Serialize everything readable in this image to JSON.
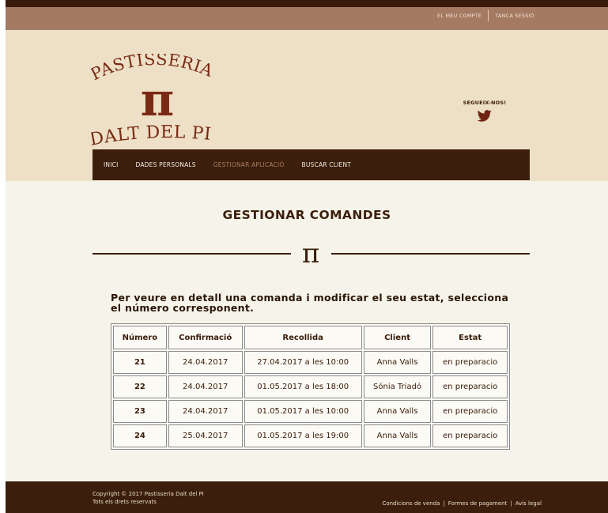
{
  "topbar": {
    "account_label": "EL MEU COMPTE",
    "logout_label": "TANCA SESSIÓ"
  },
  "logo": {
    "line1": "PASTISSERIA",
    "symbol": "π",
    "line2": "DALT DEL PI"
  },
  "social": {
    "label": "SEGUEIX-NOS!",
    "icon": "twitter-icon"
  },
  "nav": {
    "items": [
      {
        "label": "INICI",
        "active": false
      },
      {
        "label": "DADES PERSONALS",
        "active": false
      },
      {
        "label": "GESTIONAR APLICACIÓ",
        "active": true
      },
      {
        "label": "BUSCAR CLIENT",
        "active": false
      }
    ]
  },
  "main": {
    "title": "GESTIONAR COMANDES",
    "divider_symbol": "π",
    "intro": "Per veure en detall una comanda i modificar el seu estat, selecciona el número corresponent."
  },
  "table": {
    "headers": [
      "Número",
      "Confirmació",
      "Recollida",
      "Client",
      "Estat"
    ],
    "rows": [
      [
        "21",
        "24.04.2017",
        "27.04.2017 a les 10:00",
        "Anna Valls",
        "en preparacio"
      ],
      [
        "22",
        "24.04.2017",
        "01.05.2017 a les 18:00",
        "Sónia Triadó",
        "en preparacio"
      ],
      [
        "23",
        "24.04.2017",
        "01.05.2017 a les 10:00",
        "Anna Valls",
        "en preparacio"
      ],
      [
        "24",
        "25.04.2017",
        "01.05.2017 a les 19:00",
        "Anna Valls",
        "en preparacio"
      ]
    ]
  },
  "footer": {
    "copyright": "Copyright © 2017 Pastisseria Dalt del Pi",
    "rights": "Tots els drets reservats",
    "links": [
      "Condicions de venda",
      "Formes de pagament",
      "Avís legal"
    ]
  },
  "colors": {
    "topbar": "#a57a62",
    "header": "#ede0c6",
    "brand_dark": "#3b1e0b",
    "logo_red": "#7a2a14",
    "main_bg": "#f6f4ea",
    "nav_active": "#a97d63"
  }
}
